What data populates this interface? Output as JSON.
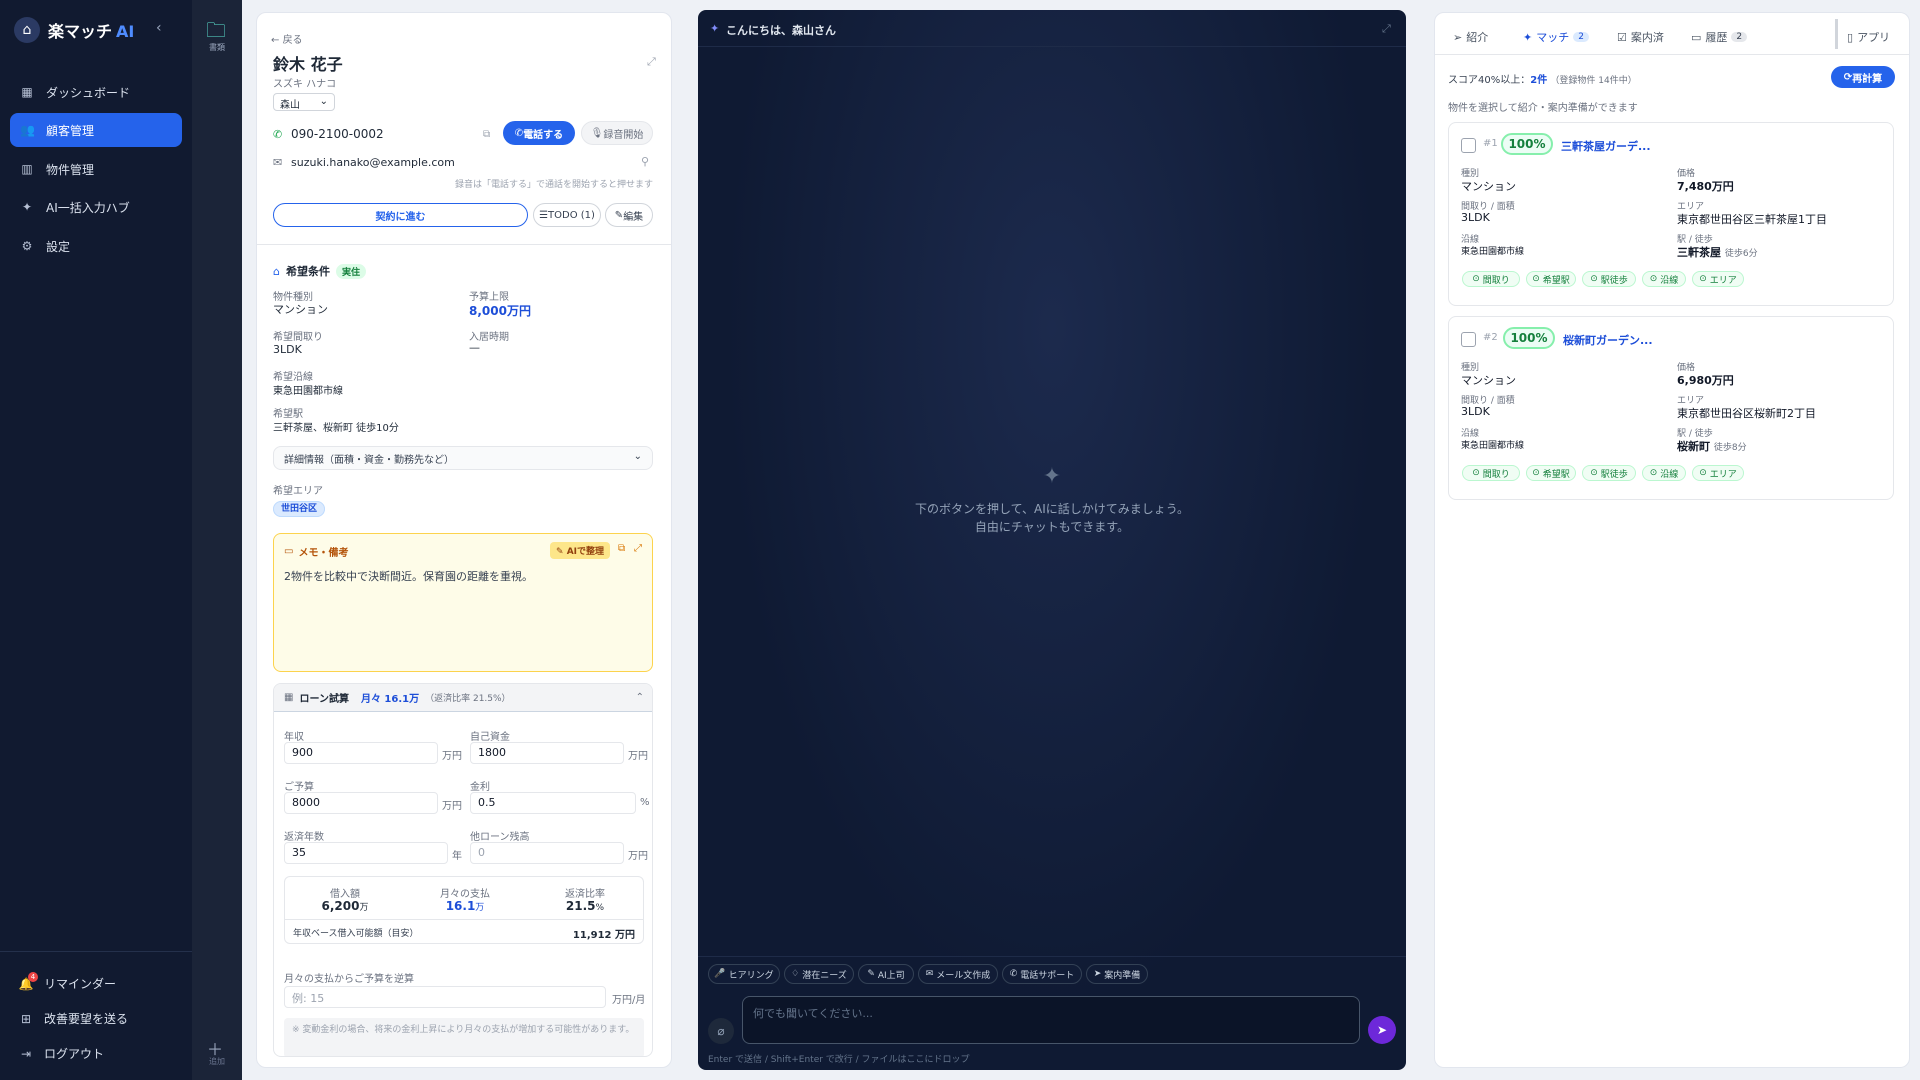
{
  "sidebar": {
    "brand": "楽マッチ",
    "brand_ai": "AI",
    "items": [
      {
        "label": "ダッシュボード"
      },
      {
        "label": "顧客管理"
      },
      {
        "label": "物件管理"
      },
      {
        "label": "AI一括入力ハブ"
      },
      {
        "label": "設定"
      }
    ],
    "reminder": "リマインダー",
    "reminder_count": "4",
    "feedback": "改善要望を送る",
    "logout": "ログアウト"
  },
  "rail": {
    "folder_label": "書類",
    "add_label": "追加"
  },
  "customer": {
    "back": "戻る",
    "name": "鈴木 花子",
    "kana": "スズキ ハナコ",
    "assignee": "森山",
    "phone": "090-2100-0002",
    "call_button": "電話する",
    "record_button": "録音開始",
    "email": "suzuki.hanako@example.com",
    "record_note": "録音は「電話する」で通話を開始すると押せます",
    "contract_button": "契約に進む",
    "todo_button": "TODO (1)",
    "edit_button": "編集",
    "conditions_title": "希望条件",
    "conditions_badge": "実住",
    "property_type_label": "物件種別",
    "property_type": "マンション",
    "budget_label": "予算上限",
    "budget": "8,000万円",
    "layout_label": "希望間取り",
    "layout": "3LDK",
    "move_in_label": "入居時期",
    "move_in": "—",
    "line_label": "希望沿線",
    "line": "東急田園都市線",
    "station_label": "希望駅",
    "station": "三軒茶屋、桜新町 徒歩10分",
    "details_toggle": "詳細情報（面積・資金・勤務先など）",
    "area_label": "希望エリア",
    "area": "世田谷区",
    "memo_title": "メモ・備考",
    "memo_ai_button": "AIで整理",
    "memo_text": "2物件を比較中で決断間近。保育園の距離を重視。",
    "loan": {
      "title": "ローン試算",
      "monthly_summary": "月々 16.1万",
      "ratio_summary": "（返済比率 21.5%）",
      "income_label": "年収",
      "income": "900",
      "own_funds_label": "自己資金",
      "own_funds": "1800",
      "budget_label": "ご予算",
      "budget": "8000",
      "rate_label": "金利",
      "rate": "0.5",
      "years_label": "返済年数",
      "years": "35",
      "other_loan_label": "他ローン残高",
      "other_loan_placeholder": "0",
      "unit_man": "万円",
      "unit_pct": "%",
      "unit_year": "年",
      "borrow_label": "借入額",
      "borrow_value": "6,200",
      "borrow_unit": "万",
      "monthly_label": "月々の支払",
      "monthly_value": "16.1",
      "monthly_unit": "万",
      "ratio_label": "返済比率",
      "ratio_value": "21.5",
      "ratio_unit": "%",
      "capacity_label": "年収ベース借入可能額（目安）",
      "capacity_value": "11,912 万円",
      "reverse_label": "月々の支払からご予算を逆算",
      "reverse_placeholder": "例: 15",
      "reverse_unit": "万円/月",
      "note": "※ 変動金利の場合、将来の金利上昇により月々の支払が増加する可能性があります。"
    }
  },
  "chat": {
    "greeting": "こんにちは、森山さん",
    "empty_line1": "下のボタンを押して、AIに話しかけてみましょう。",
    "empty_line2": "自由にチャットもできます。",
    "chips": [
      "ヒアリング",
      "潜在ニーズ",
      "AI上司",
      "メール文作成",
      "電話サポート",
      "案内準備"
    ],
    "input_placeholder": "何でも聞いてください...",
    "hint": "Enter で送信 / Shift+Enter で改行 / ファイルはここにドロップ"
  },
  "match": {
    "tabs": [
      {
        "label": "紹介",
        "count": ""
      },
      {
        "label": "マッチ",
        "count": "2"
      },
      {
        "label": "案内済",
        "count": ""
      },
      {
        "label": "履歴",
        "count": "2"
      }
    ],
    "app_tab": "アプリ",
    "summary_prefix": "スコア40%以上：",
    "summary_count": "2件",
    "summary_total": "（登録物件 14件中）",
    "recalc_button": "再計算",
    "hint": "物件を選択して紹介・案内準備ができます",
    "labels": {
      "type": "種別",
      "price": "価格",
      "layout": "間取り / 面積",
      "area": "エリア",
      "line": "沿線",
      "station": "駅 / 徒歩"
    },
    "chip_labels": [
      "間取り",
      "希望駅",
      "駅徒歩",
      "沿線",
      "エリア"
    ],
    "cards": [
      {
        "rank": "#1",
        "score": "100%",
        "name": "三軒茶屋ガーデ...",
        "type": "マンション",
        "price": "7,480万円",
        "layout": "3LDK",
        "area": "東京都世田谷区三軒茶屋1丁目",
        "line": "東急田園都市線",
        "station": "三軒茶屋",
        "walk": "徒歩6分"
      },
      {
        "rank": "#2",
        "score": "100%",
        "name": "桜新町ガーデン...",
        "type": "マンション",
        "price": "6,980万円",
        "layout": "3LDK",
        "area": "東京都世田谷区桜新町2丁目",
        "line": "東急田園都市線",
        "station": "桜新町",
        "walk": "徒歩8分"
      }
    ]
  },
  "colors": {
    "accent": "#2563eb",
    "sidebar_bg": "#111a30",
    "chat_bg": "#0f1a33",
    "match_green": "#15803d",
    "memo_bg": "#fefce8"
  }
}
